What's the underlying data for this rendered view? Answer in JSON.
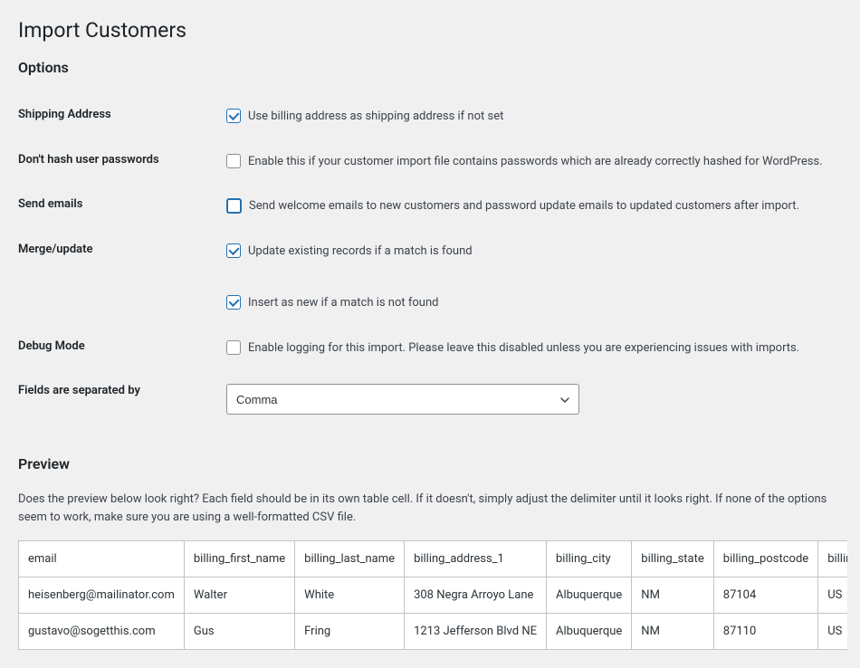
{
  "page": {
    "title": "Import Customers",
    "options_heading": "Options",
    "preview_heading": "Preview",
    "preview_description": "Does the preview below look right? Each field should be in its own table cell. If it doesn't, simply adjust the delimiter until it looks right. If none of the options seem to work, make sure you are using a well-formatted CSV file."
  },
  "options": {
    "shipping": {
      "label": "Shipping Address",
      "text": "Use billing address as shipping address if not set",
      "checked": true
    },
    "passwords": {
      "label": "Don't hash user passwords",
      "text": "Enable this if your customer import file contains passwords which are already correctly hashed for WordPress.",
      "checked": false
    },
    "emails": {
      "label": "Send emails",
      "text": "Send welcome emails to new customers and password update emails to updated customers after import.",
      "checked": false
    },
    "merge": {
      "label": "Merge/update",
      "update_text": "Update existing records if a match is found",
      "insert_text": "Insert as new if a match is not found",
      "update_checked": true,
      "insert_checked": true
    },
    "debug": {
      "label": "Debug Mode",
      "text": "Enable logging for this import. Please leave this disabled unless you are experiencing issues with imports.",
      "checked": false
    },
    "separator": {
      "label": "Fields are separated by",
      "selected": "Comma"
    }
  },
  "preview_table": {
    "headers": [
      "email",
      "billing_first_name",
      "billing_last_name",
      "billing_address_1",
      "billing_city",
      "billing_state",
      "billing_postcode",
      "billing_country"
    ],
    "header_display": {
      "7": "billing"
    },
    "rows": [
      {
        "email": "heisenberg@mailinator.com",
        "first": "Walter",
        "last": "White",
        "address": "308 Negra Arroyo Lane",
        "city": "Albuquerque",
        "state": "NM",
        "postcode": "87104",
        "country": "US"
      },
      {
        "email": "gustavo@sogetthis.com",
        "first": "Gus",
        "last": "Fring",
        "address": "1213 Jefferson Blvd NE",
        "city": "Albuquerque",
        "state": "NM",
        "postcode": "87110",
        "country": "US"
      }
    ]
  }
}
